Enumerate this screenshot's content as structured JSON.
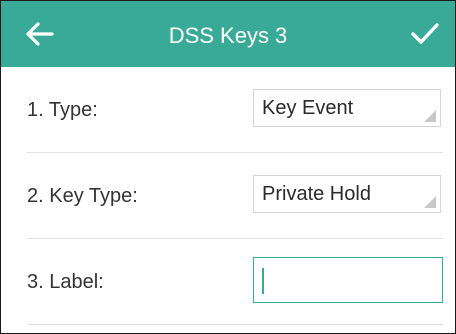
{
  "header": {
    "title": "DSS Keys 3",
    "back_icon": "arrow-left-icon",
    "confirm_icon": "checkmark-icon",
    "color": "#3aaa98"
  },
  "fields": [
    {
      "label": "1. Type:",
      "value": "Key Event",
      "control": "select"
    },
    {
      "label": "2. Key Type:",
      "value": "Private Hold",
      "control": "select"
    },
    {
      "label": "3. Label:",
      "value": "",
      "control": "text-input"
    }
  ]
}
